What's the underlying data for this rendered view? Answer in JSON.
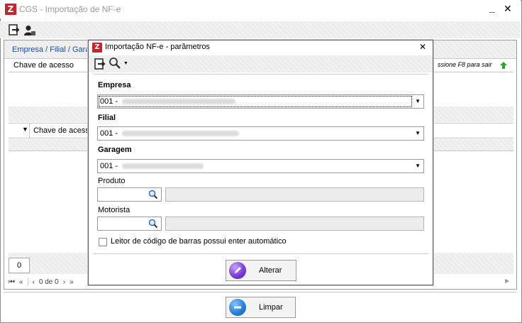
{
  "main_window": {
    "title": "CGS - Importação de NF-e",
    "minimize_glyph": "_",
    "close_glyph": "✕",
    "logo_text": "Z"
  },
  "background": {
    "company_label": "Empresa / Filial / Gara",
    "chave_label": "Chave de acesso",
    "hint": "ssione F8 para sair",
    "grid_column_label": "Chave de acess",
    "grid_sort_glyph": "▼",
    "count": "0",
    "pager": {
      "first": "⏮",
      "prev_page": "«",
      "prev": "‹",
      "text": "0 de 0",
      "next": "›",
      "next_page": "»"
    },
    "limpar_label": "Limpar"
  },
  "dialog": {
    "title": "Importação NF-e - parâmetros",
    "close_glyph": "✕",
    "logo_text": "Z",
    "empresa_label": "Empresa",
    "empresa_value": "001 -",
    "filial_label": "Filial",
    "filial_value": "001 -",
    "garagem_label": "Garagem",
    "garagem_value": "001 -",
    "produto_label": "Produto",
    "motorista_label": "Motorista",
    "checkbox_label": "Leitor de código de barras possui enter automático",
    "alterar_label": "Alterar"
  },
  "colors": {
    "brand_red": "#c8232c",
    "link_blue": "#1a4db3",
    "limpar_icon": "#2b7fd6",
    "alterar_icon": "#7a3fd6"
  }
}
